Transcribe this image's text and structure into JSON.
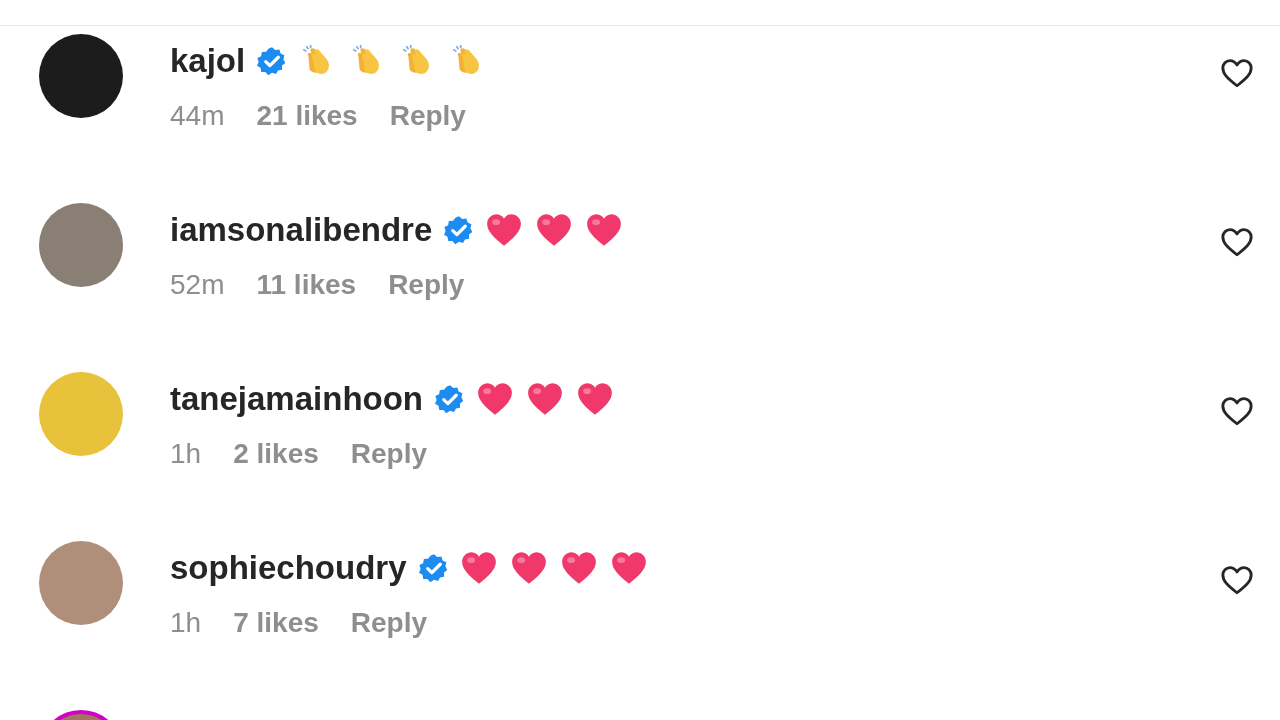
{
  "comments": [
    {
      "username": "kajol",
      "verified": true,
      "emojis": [
        {
          "kind": "clap"
        },
        {
          "kind": "clap"
        },
        {
          "kind": "clap"
        },
        {
          "kind": "clap"
        }
      ],
      "time": "44m",
      "likes": "21 likes",
      "reply": "Reply",
      "liked": false
    },
    {
      "username": "iamsonalibendre",
      "verified": true,
      "emojis": [
        {
          "kind": "heart"
        },
        {
          "kind": "heart"
        },
        {
          "kind": "heart"
        }
      ],
      "time": "52m",
      "likes": "11 likes",
      "reply": "Reply",
      "liked": false
    },
    {
      "username": "tanejamainhoon",
      "verified": true,
      "emojis": [
        {
          "kind": "heart"
        },
        {
          "kind": "heart"
        },
        {
          "kind": "heart"
        }
      ],
      "time": "1h",
      "likes": "2 likes",
      "reply": "Reply",
      "liked": false
    },
    {
      "username": "sophiechoudry",
      "verified": true,
      "emojis": [
        {
          "kind": "heart"
        },
        {
          "kind": "heart"
        },
        {
          "kind": "heart"
        },
        {
          "kind": "heart"
        }
      ],
      "time": "1h",
      "likes": "7 likes",
      "reply": "Reply",
      "liked": false
    }
  ],
  "cut_off_avatar": {
    "story_ring": true
  }
}
